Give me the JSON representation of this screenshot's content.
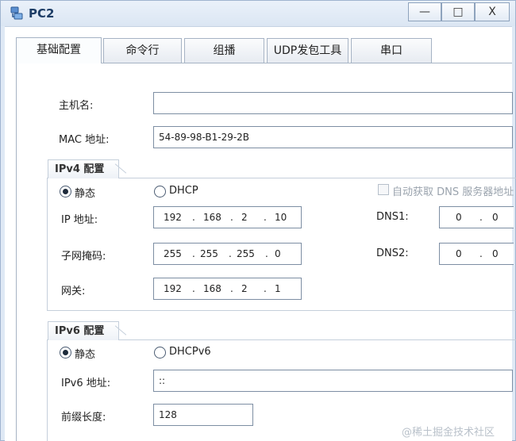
{
  "window": {
    "title": "PC2",
    "minimize_glyph": "—",
    "maximize_glyph": "□",
    "close_glyph": "X"
  },
  "tabs": [
    {
      "label": "基础配置",
      "active": true
    },
    {
      "label": "命令行",
      "active": false
    },
    {
      "label": "组播",
      "active": false
    },
    {
      "label": "UDP发包工具",
      "active": false
    },
    {
      "label": "串口",
      "active": false
    }
  ],
  "basic": {
    "hostname_label": "主机名:",
    "hostname_value": "",
    "mac_label": "MAC 地址:",
    "mac_value": "54-89-98-B1-29-2B"
  },
  "ipv4": {
    "group_title": "IPv4 配置",
    "static_label": "静态",
    "dhcp_label": "DHCP",
    "auto_dns_label": "自动获取 DNS 服务器地址",
    "ip_label": "IP 地址:",
    "ip_octets": [
      "192",
      "168",
      "2",
      "10"
    ],
    "mask_label": "子网掩码:",
    "mask_octets": [
      "255",
      "255",
      "255",
      "0"
    ],
    "gateway_label": "网关:",
    "gateway_octets": [
      "192",
      "168",
      "2",
      "1"
    ],
    "dns1_label": "DNS1:",
    "dns1_octets": [
      "0",
      "0"
    ],
    "dns2_label": "DNS2:",
    "dns2_octets": [
      "0",
      "0"
    ],
    "dot": "."
  },
  "ipv6": {
    "group_title": "IPv6 配置",
    "static_label": "静态",
    "dhcp_label": "DHCPv6",
    "ip_label": "IPv6 地址:",
    "ip_value": "::",
    "prefix_label": "前缀长度:",
    "prefix_value": "128"
  },
  "watermark": "@稀土掘金技术社区",
  "colors": {
    "title_text": "#1d3d66",
    "window_bg": "#dfe9f5",
    "field_border": "#7d8ea3"
  }
}
